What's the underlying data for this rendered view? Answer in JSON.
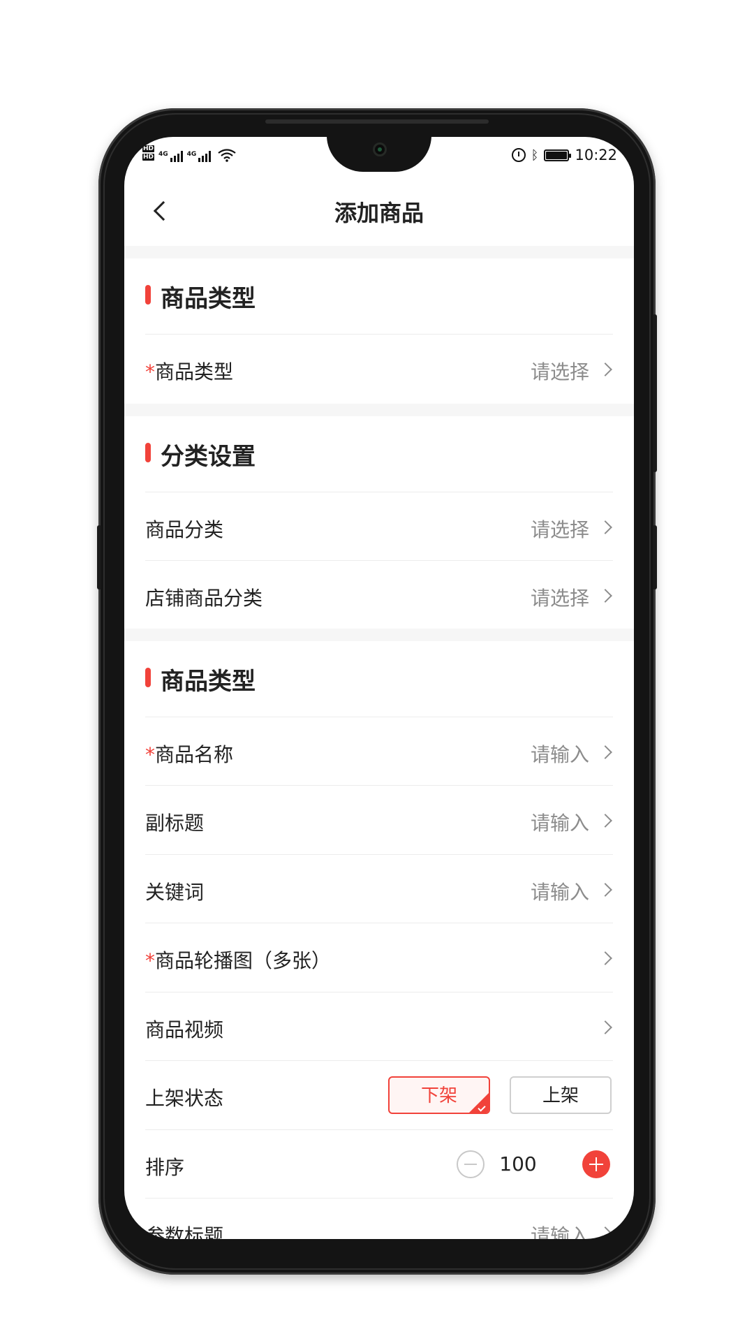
{
  "status_bar": {
    "net1": "4G",
    "net2": "4G",
    "time": "10:22"
  },
  "header": {
    "title": "添加商品"
  },
  "sections": [
    {
      "title": "商品类型",
      "rows": [
        {
          "required": "*",
          "label": "商品类型",
          "value": "请选择"
        }
      ]
    },
    {
      "title": "分类设置",
      "rows": [
        {
          "label": "商品分类",
          "value": "请选择"
        },
        {
          "label": "店铺商品分类",
          "value": "请选择"
        }
      ]
    },
    {
      "title": "商品类型",
      "rows": [
        {
          "required": "*",
          "label": "商品名称",
          "value": "请输入"
        },
        {
          "label": "副标题",
          "value": "请输入"
        },
        {
          "label": "关键词",
          "value": "请输入"
        },
        {
          "required": "*",
          "label": "商品轮播图（多张）"
        },
        {
          "label": "商品视频"
        },
        {
          "label": "上架状态",
          "options": [
            "下架",
            "上架"
          ],
          "selected": "下架"
        },
        {
          "label": "排序",
          "stepper_value": "100"
        },
        {
          "label": "参数标题",
          "value": "请输入"
        }
      ]
    }
  ],
  "colors": {
    "accent": "#f1423a",
    "placeholder": "#8c8c8c",
    "divider": "#ececec",
    "background_gap": "#f6f6f6"
  },
  "icons": [
    "back-arrow-icon",
    "chevron-right-icon",
    "minus-circle-icon",
    "plus-circle-icon",
    "check-icon",
    "wifi-icon",
    "alarm-icon",
    "bluetooth-icon",
    "battery-icon"
  ]
}
